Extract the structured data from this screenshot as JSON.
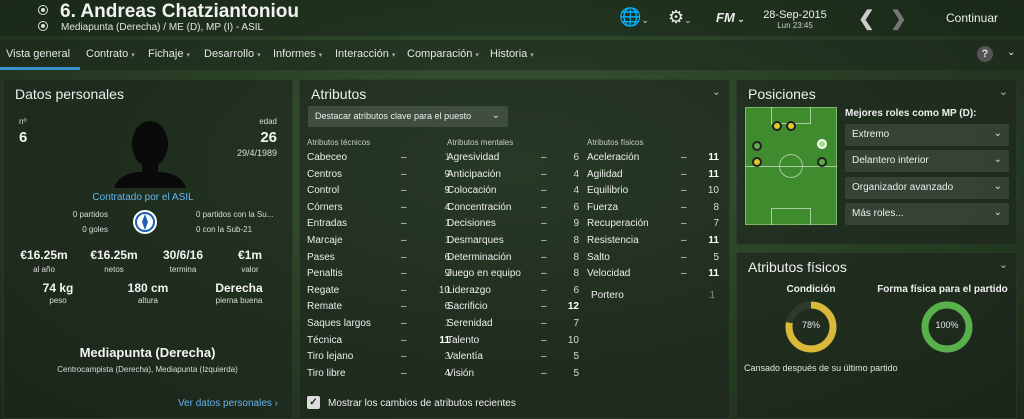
{
  "header": {
    "title": "6. Andreas Chatziantoniou",
    "subtitle": "Mediapunta (Derecha) / ME (D), MP (I) - ASIL",
    "fm": "FM",
    "date": "28-Sep-2015",
    "time": "Lun 23:45",
    "continue": "Continuar"
  },
  "tabs": [
    "Vista general",
    "Contrato",
    "Fichaje",
    "Desarrollo",
    "Informes",
    "Interacción",
    "Comparación",
    "Historia"
  ],
  "help": "?",
  "personal": {
    "title": "Datos personales",
    "num_label": "nº",
    "num": "6",
    "age_label": "edad",
    "age": "26",
    "dob": "29/4/1989",
    "contract": "Contratado por el ASIL",
    "left_stats": [
      "0 partidos",
      "0 goles"
    ],
    "right_stats": [
      "0 partidos con la Su...",
      "0 con la Sub-21"
    ],
    "money": [
      {
        "v": "€16.25m",
        "l": "al año"
      },
      {
        "v": "€16.25m",
        "l": "netos"
      },
      {
        "v": "30/6/16",
        "l": "termina"
      },
      {
        "v": "€1m",
        "l": "valor"
      }
    ],
    "body": [
      {
        "v": "74 kg",
        "l": "peso"
      },
      {
        "v": "180 cm",
        "l": "altura"
      },
      {
        "v": "Derecha",
        "l": "pierna buena"
      }
    ],
    "position": "Mediapunta (Derecha)",
    "positions": "Centrocampista (Derecha), Mediapunta (Izquierda)",
    "more": "Ver datos personales"
  },
  "attributes": {
    "title": "Atributos",
    "highlight": "Destacar atributos clave para el puesto",
    "tech_header": "Atributos técnicos",
    "mental_header": "Atributos mentales",
    "phys_header": "Atributos físicos",
    "technical": [
      [
        "Cabeceo",
        "1"
      ],
      [
        "Centros",
        "9"
      ],
      [
        "Control",
        "9"
      ],
      [
        "Córners",
        "4"
      ],
      [
        "Entradas",
        "1"
      ],
      [
        "Marcaje",
        "1"
      ],
      [
        "Pases",
        "6"
      ],
      [
        "Penaltis",
        "9"
      ],
      [
        "Regate",
        "10"
      ],
      [
        "Remate",
        "6"
      ],
      [
        "Saques largos",
        "1"
      ],
      [
        "Técnica",
        "11"
      ],
      [
        "Tiro lejano",
        "3"
      ],
      [
        "Tiro libre",
        "4"
      ]
    ],
    "mental": [
      [
        "Agresividad",
        "6"
      ],
      [
        "Anticipación",
        "4"
      ],
      [
        "Colocación",
        "4"
      ],
      [
        "Concentración",
        "6"
      ],
      [
        "Decisiones",
        "9"
      ],
      [
        "Desmarques",
        "8"
      ],
      [
        "Determinación",
        "8"
      ],
      [
        "Juego en equipo",
        "8"
      ],
      [
        "Liderazgo",
        "6"
      ],
      [
        "Sacrificio",
        "12"
      ],
      [
        "Serenidad",
        "7"
      ],
      [
        "Talento",
        "10"
      ],
      [
        "Valentía",
        "5"
      ],
      [
        "Visión",
        "5"
      ]
    ],
    "physical": [
      [
        "Aceleración",
        "11"
      ],
      [
        "Agilidad",
        "11"
      ],
      [
        "Equilibrio",
        "10"
      ],
      [
        "Fuerza",
        "8"
      ],
      [
        "Recuperación",
        "7"
      ],
      [
        "Resistencia",
        "11"
      ],
      [
        "Salto",
        "5"
      ],
      [
        "Velocidad",
        "11"
      ]
    ],
    "gk": [
      "Portero",
      "1"
    ],
    "dash": "–",
    "recent": "Mostrar los cambios de atributos recientes"
  },
  "positions": {
    "title": "Posiciones",
    "roles_label": "Mejores roles como MP (D):",
    "roles": [
      "Extremo",
      "Delantero interior",
      "Organizador avanzado",
      "Más roles..."
    ]
  },
  "physical_panel": {
    "title": "Atributos físicos",
    "condition_label": "Condición",
    "condition": "78%",
    "condition_value": 0.78,
    "fitness_label": "Forma física para el partido",
    "fitness": "100%",
    "fitness_value": 1.0,
    "tired": "Cansado después de su último partido"
  },
  "colors": {
    "accent": "#3a92c8",
    "condition": "#d9b93a",
    "fitness": "#58b14a",
    "link": "#62b4f0"
  }
}
